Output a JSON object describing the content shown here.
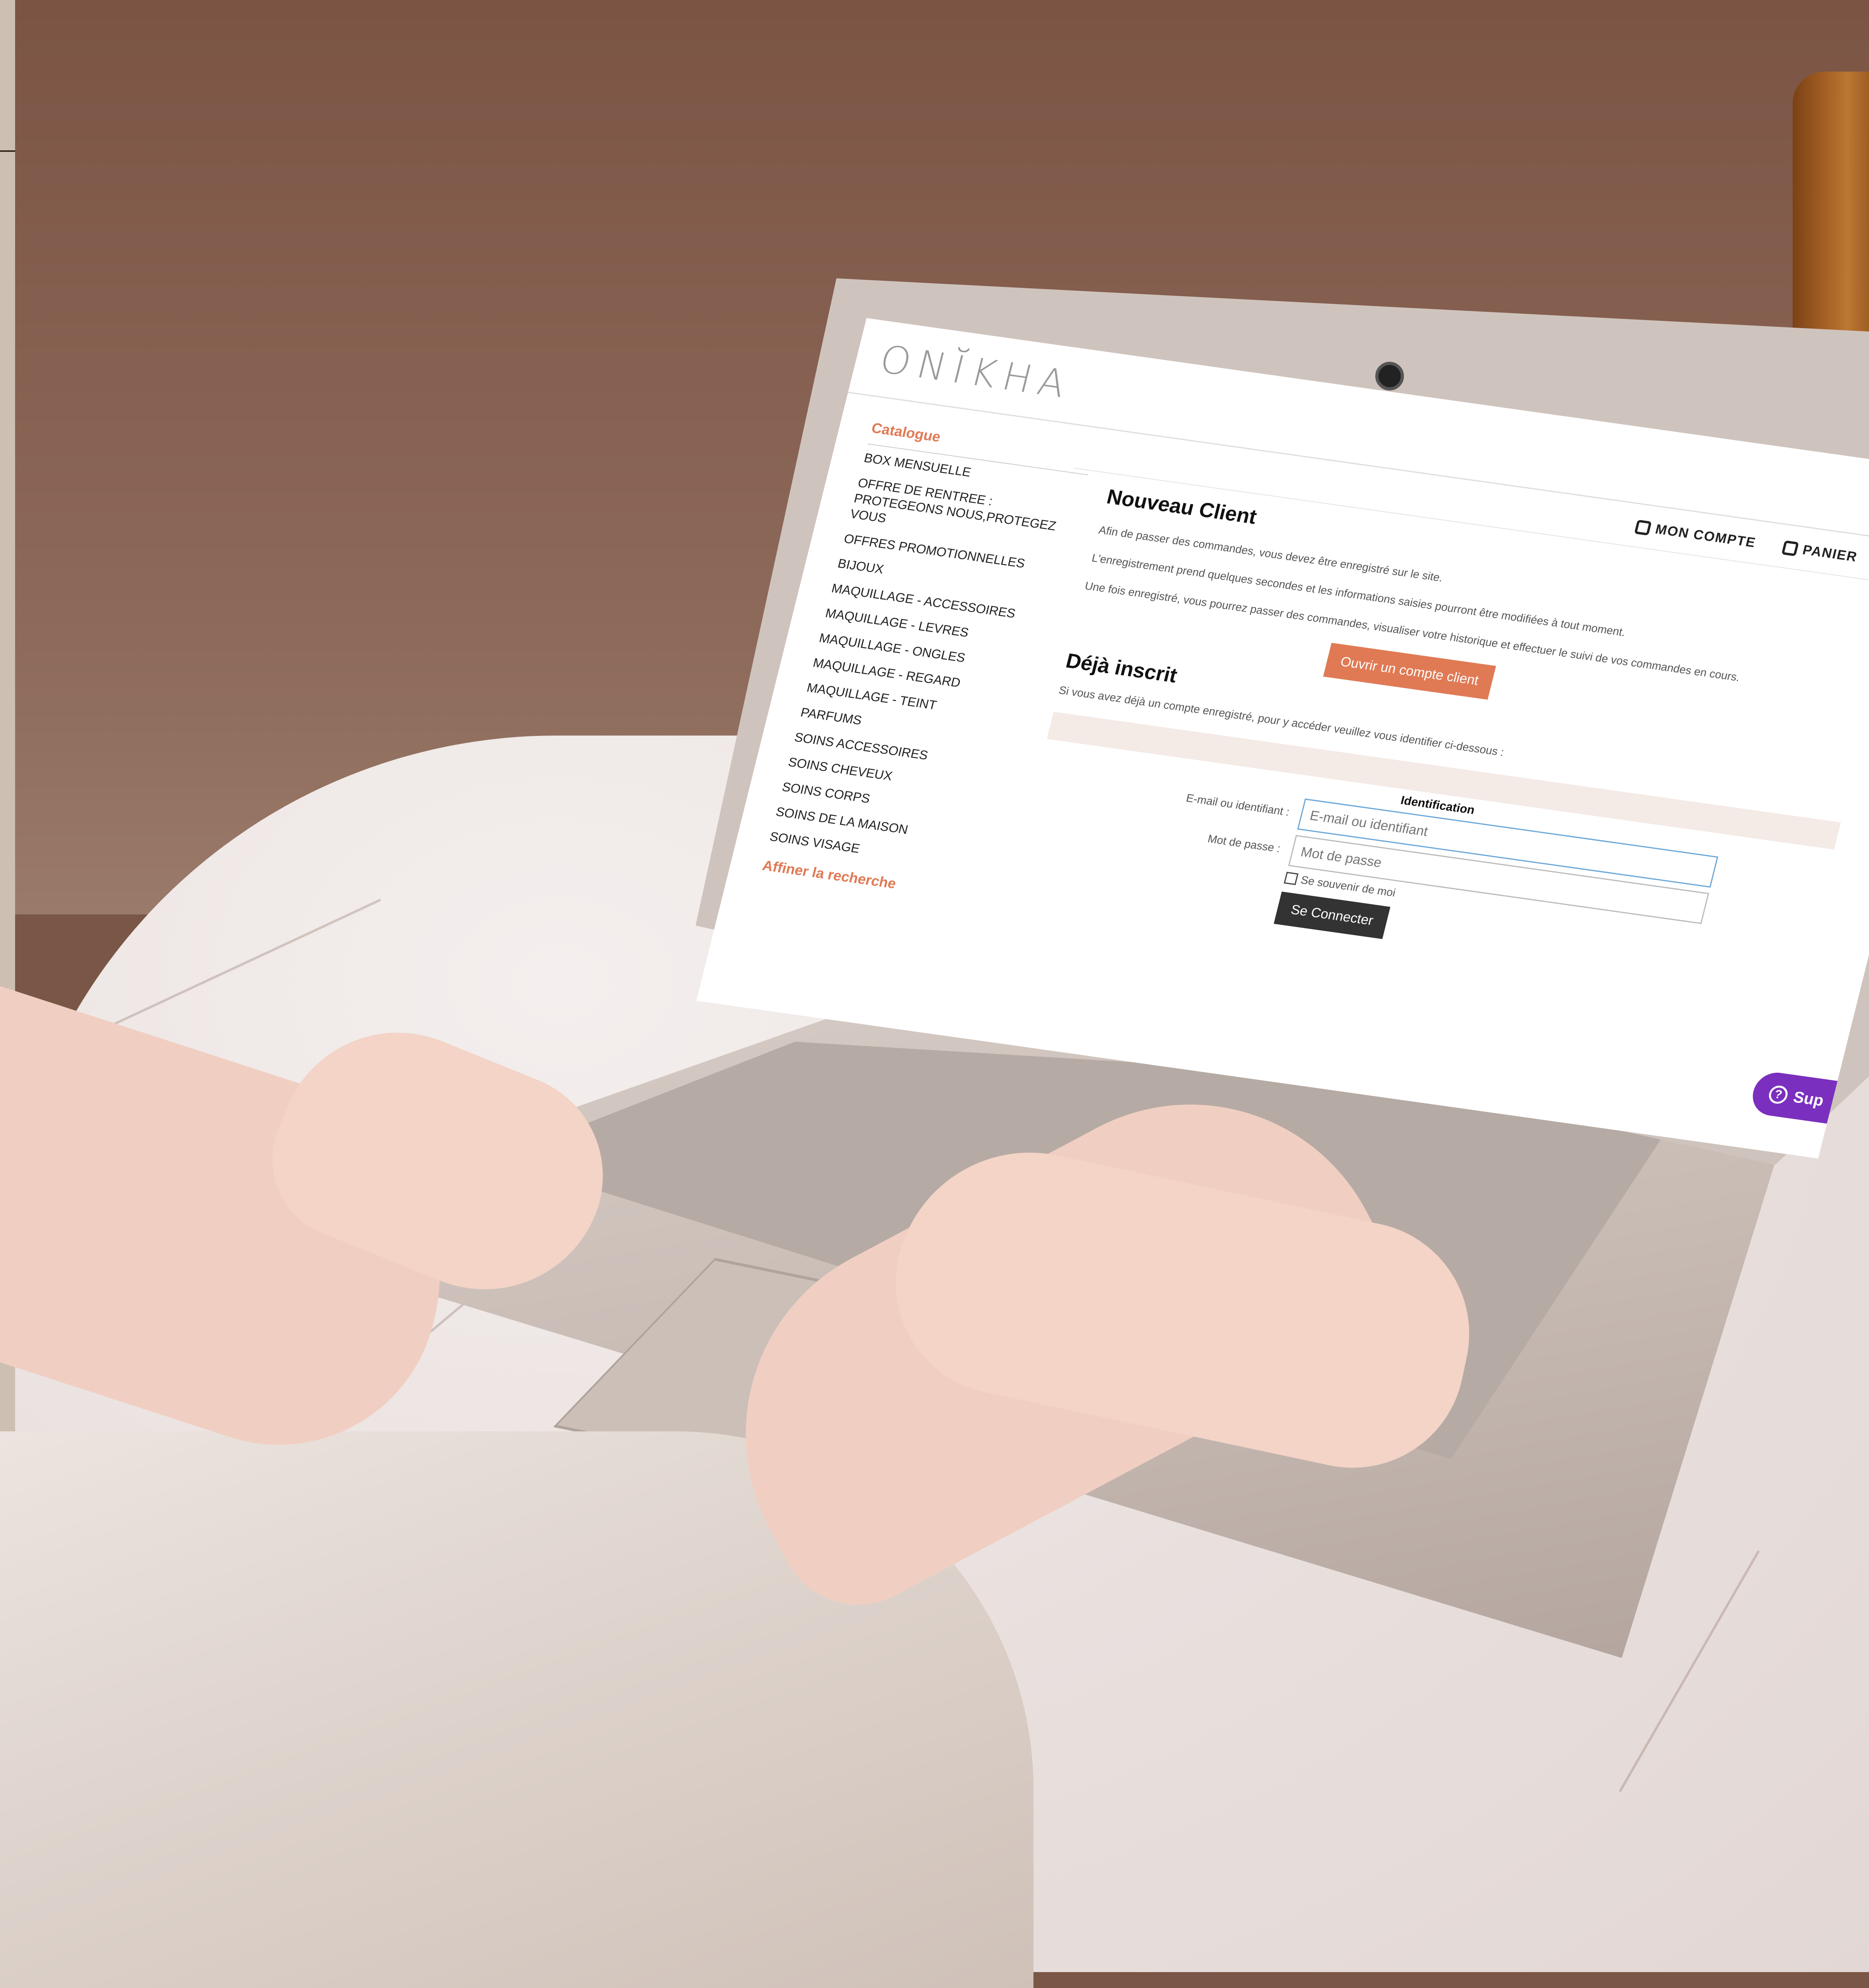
{
  "site": {
    "logo_text": "ONĬKHA"
  },
  "top_nav": {
    "account_label": "MON COMPTE",
    "cart_label": "PANIER",
    "account_icon": "user-icon",
    "cart_icon": "shopping-bag-icon",
    "instagram_icon": "instagram-icon",
    "facebook_icon": "facebook-icon"
  },
  "sidebar": {
    "catalog_title": "Catalogue",
    "items": [
      "BOX MENSUELLE",
      "OFFRE DE RENTREE : PROTEGEONS NOUS,PROTEGEZ VOUS",
      "OFFRES PROMOTIONNELLES",
      "BIJOUX",
      "MAQUILLAGE - ACCESSOIRES",
      "MAQUILLAGE - LEVRES",
      "MAQUILLAGE - ONGLES",
      "MAQUILLAGE - REGARD",
      "MAQUILLAGE - TEINT",
      "PARFUMS",
      "SOINS ACCESSOIRES",
      "SOINS CHEVEUX",
      "SOINS CORPS",
      "SOINS DE LA MAISON",
      "SOINS VISAGE"
    ],
    "refine_title": "Affiner la recherche"
  },
  "new_client": {
    "heading": "Nouveau Client",
    "para1": "Afin de passer des commandes, vous devez être enregistré sur le site.",
    "para2": "L'enregistrement prend quelques secondes et les informations saisies pourront être modifiées à tout moment.",
    "para3": "Une fois enregistré, vous pourrez passer des commandes, visualiser votre historique et effectuer le suivi de vos commandes en cours.",
    "open_account_button": "Ouvrir un compte client"
  },
  "existing_client": {
    "heading": "Déjà inscrit",
    "intro": "Si vous avez déjà un compte enregistré, pour y accéder veuillez vous identifier ci-dessous :",
    "panel_title": "Identification",
    "email_label": "E-mail ou identifiant :",
    "email_placeholder": "E-mail ou identifiant",
    "password_label": "Mot de passe :",
    "password_placeholder": "Mot de passe",
    "remember_label": "Se souvenir de moi",
    "login_button": "Se Connecter"
  },
  "support_widget": {
    "label": "Sup",
    "icon": "help-circle-icon"
  },
  "colors": {
    "accent": "#e07a55",
    "support": "#7b2fbe",
    "dark_button": "#333333"
  }
}
